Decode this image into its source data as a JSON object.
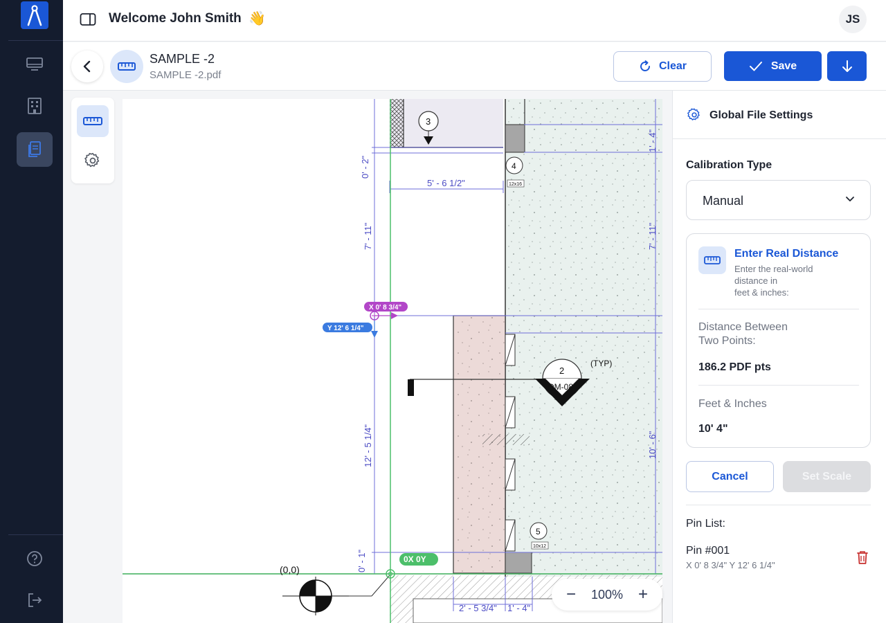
{
  "topbar": {
    "welcome": "Welcome John Smith",
    "wave": "👋",
    "avatar_initials": "JS"
  },
  "file": {
    "title": "SAMPLE -2",
    "filename": "SAMPLE -2.pdf"
  },
  "actions": {
    "clear_label": "Clear",
    "save_label": "Save"
  },
  "drawing": {
    "origin_label": "(0,0)",
    "zero_tag": "0X 0Y",
    "x_tag": "X 0' 8 3/4\"",
    "y_tag": "Y 12' 6 1/4\"",
    "dims": {
      "d1": "0' - 2\"",
      "d2": "5' - 6 1/2\"",
      "d3": "7' - 11\"",
      "d4": "12' - 5 1/4\"",
      "d5": "0' - 1\"",
      "d6": "1' - 4\"",
      "d7": "7' - 11\"",
      "d8": "10' - 6\"",
      "d9": "2' - 5 3/4\"",
      "d10": "1' - 4\""
    },
    "callouts": {
      "c3": "3",
      "c4": "4",
      "c4_tag": "12x16",
      "c2": "2",
      "c2_ref": "DM-08",
      "typ": "(TYP)",
      "c5": "5",
      "c5_tag": "10x12"
    }
  },
  "zoom": {
    "minus": "−",
    "value": "100%",
    "plus": "+"
  },
  "panel": {
    "header": "Global File Settings",
    "calibration_label": "Calibration Type",
    "calibration_value": "Manual",
    "card": {
      "title": "Enter Real Distance",
      "desc_line1": "Enter the real-world",
      "desc_line2": "distance in",
      "desc_line3": "feet & inches:",
      "distance_label_1": "Distance Between",
      "distance_label_2": "Two Points:",
      "distance_value": "186.2 PDF pts",
      "feet_label": "Feet & Inches",
      "feet_value": "10' 4\""
    },
    "cancel_label": "Cancel",
    "set_scale_label": "Set Scale",
    "pin_list_label": "Pin List:",
    "pins": [
      {
        "name": "Pin #001",
        "coords": "X 0' 8 3/4\"   Y 12' 6 1/4\""
      }
    ]
  },
  "colors": {
    "accent": "#1a57d6",
    "rail": "#141c2e",
    "delete": "#c8302f",
    "calib_magenta": "#b246c8",
    "calib_blue": "#3b7be0",
    "origin_green": "#4cbf6a"
  }
}
